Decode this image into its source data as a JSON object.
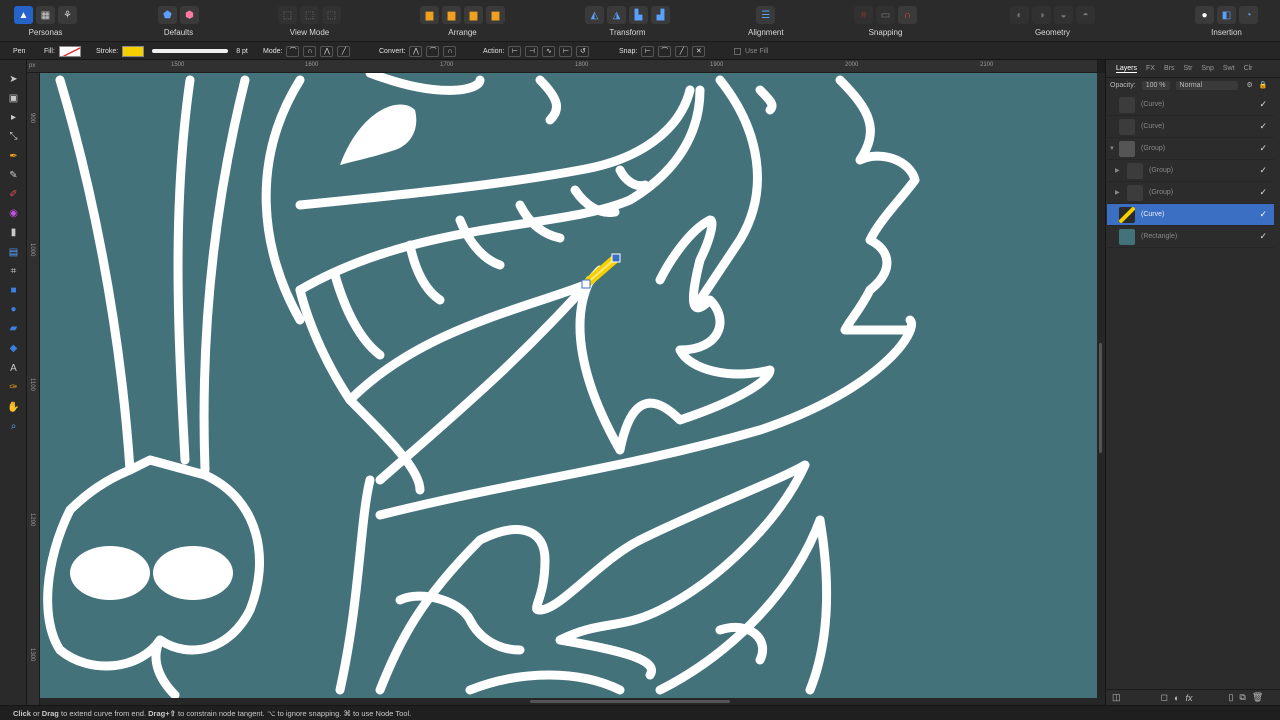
{
  "toolbar": {
    "personas_label": "Personas",
    "groups": [
      {
        "label": "Defaults"
      },
      {
        "label": "View Mode"
      },
      {
        "label": "Arrange"
      },
      {
        "label": "Transform"
      },
      {
        "label": "Alignment"
      },
      {
        "label": "Snapping"
      },
      {
        "label": "Geometry"
      },
      {
        "label": "Insertion"
      }
    ]
  },
  "context": {
    "tool_name": "Pen",
    "fill_label": "Fill:",
    "stroke_label": "Stroke:",
    "stroke_color": "#f5d000",
    "stroke_width": "8 pt",
    "mode_label": "Mode:",
    "convert_label": "Convert:",
    "action_label": "Action:",
    "snap_label": "Snap:",
    "use_fill_label": "Use Fill"
  },
  "ruler": {
    "unit": "px",
    "h_ticks": [
      "1500",
      "1600",
      "1700",
      "1800",
      "1900",
      "2000",
      "2100"
    ],
    "v_ticks": [
      "900",
      "1000",
      "1100",
      "1200",
      "1300"
    ]
  },
  "canvas": {
    "background": "#43727b",
    "line_color": "#ffffff",
    "accent": "#f5d000"
  },
  "layers_panel": {
    "tabs": [
      "Layers",
      "FX",
      "Brs",
      "Str",
      "Snp",
      "Swt",
      "Clr"
    ],
    "opacity_label": "Opacity:",
    "opacity_value": "100 %",
    "blend_mode": "Normal",
    "items": [
      {
        "name": "(Curve)",
        "expanded": false,
        "selected": false,
        "visible": true
      },
      {
        "name": "(Curve)",
        "expanded": false,
        "selected": false,
        "visible": true
      },
      {
        "name": "(Group)",
        "expanded": true,
        "selected": false,
        "visible": true
      },
      {
        "name": "(Group)",
        "expanded": false,
        "selected": false,
        "visible": true
      },
      {
        "name": "(Group)",
        "expanded": false,
        "selected": false,
        "visible": true
      },
      {
        "name": "(Curve)",
        "expanded": false,
        "selected": true,
        "visible": true
      },
      {
        "name": "(Rectangle)",
        "expanded": false,
        "selected": false,
        "visible": true
      }
    ]
  },
  "status": {
    "click": "Click",
    "or": "or",
    "drag": "Drag",
    "extend": "to extend curve from end.",
    "drag_shift": "Drag+⇧",
    "constrain": "to constrain node tangent.",
    "ignore": "⌥ to ignore snapping.",
    "node_tool": "⌘ to use Node Tool."
  }
}
